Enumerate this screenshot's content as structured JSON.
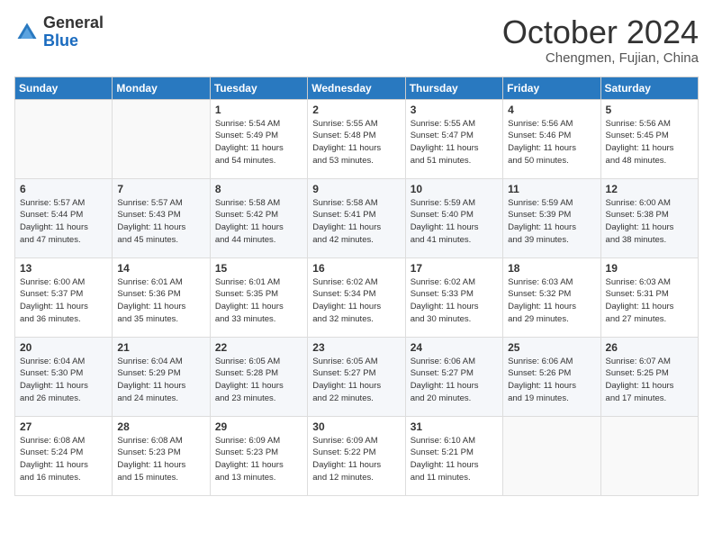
{
  "header": {
    "logo_general": "General",
    "logo_blue": "Blue",
    "month": "October 2024",
    "location": "Chengmen, Fujian, China"
  },
  "weekdays": [
    "Sunday",
    "Monday",
    "Tuesday",
    "Wednesday",
    "Thursday",
    "Friday",
    "Saturday"
  ],
  "weeks": [
    [
      {
        "day": "",
        "info": ""
      },
      {
        "day": "",
        "info": ""
      },
      {
        "day": "1",
        "info": "Sunrise: 5:54 AM\nSunset: 5:49 PM\nDaylight: 11 hours\nand 54 minutes."
      },
      {
        "day": "2",
        "info": "Sunrise: 5:55 AM\nSunset: 5:48 PM\nDaylight: 11 hours\nand 53 minutes."
      },
      {
        "day": "3",
        "info": "Sunrise: 5:55 AM\nSunset: 5:47 PM\nDaylight: 11 hours\nand 51 minutes."
      },
      {
        "day": "4",
        "info": "Sunrise: 5:56 AM\nSunset: 5:46 PM\nDaylight: 11 hours\nand 50 minutes."
      },
      {
        "day": "5",
        "info": "Sunrise: 5:56 AM\nSunset: 5:45 PM\nDaylight: 11 hours\nand 48 minutes."
      }
    ],
    [
      {
        "day": "6",
        "info": "Sunrise: 5:57 AM\nSunset: 5:44 PM\nDaylight: 11 hours\nand 47 minutes."
      },
      {
        "day": "7",
        "info": "Sunrise: 5:57 AM\nSunset: 5:43 PM\nDaylight: 11 hours\nand 45 minutes."
      },
      {
        "day": "8",
        "info": "Sunrise: 5:58 AM\nSunset: 5:42 PM\nDaylight: 11 hours\nand 44 minutes."
      },
      {
        "day": "9",
        "info": "Sunrise: 5:58 AM\nSunset: 5:41 PM\nDaylight: 11 hours\nand 42 minutes."
      },
      {
        "day": "10",
        "info": "Sunrise: 5:59 AM\nSunset: 5:40 PM\nDaylight: 11 hours\nand 41 minutes."
      },
      {
        "day": "11",
        "info": "Sunrise: 5:59 AM\nSunset: 5:39 PM\nDaylight: 11 hours\nand 39 minutes."
      },
      {
        "day": "12",
        "info": "Sunrise: 6:00 AM\nSunset: 5:38 PM\nDaylight: 11 hours\nand 38 minutes."
      }
    ],
    [
      {
        "day": "13",
        "info": "Sunrise: 6:00 AM\nSunset: 5:37 PM\nDaylight: 11 hours\nand 36 minutes."
      },
      {
        "day": "14",
        "info": "Sunrise: 6:01 AM\nSunset: 5:36 PM\nDaylight: 11 hours\nand 35 minutes."
      },
      {
        "day": "15",
        "info": "Sunrise: 6:01 AM\nSunset: 5:35 PM\nDaylight: 11 hours\nand 33 minutes."
      },
      {
        "day": "16",
        "info": "Sunrise: 6:02 AM\nSunset: 5:34 PM\nDaylight: 11 hours\nand 32 minutes."
      },
      {
        "day": "17",
        "info": "Sunrise: 6:02 AM\nSunset: 5:33 PM\nDaylight: 11 hours\nand 30 minutes."
      },
      {
        "day": "18",
        "info": "Sunrise: 6:03 AM\nSunset: 5:32 PM\nDaylight: 11 hours\nand 29 minutes."
      },
      {
        "day": "19",
        "info": "Sunrise: 6:03 AM\nSunset: 5:31 PM\nDaylight: 11 hours\nand 27 minutes."
      }
    ],
    [
      {
        "day": "20",
        "info": "Sunrise: 6:04 AM\nSunset: 5:30 PM\nDaylight: 11 hours\nand 26 minutes."
      },
      {
        "day": "21",
        "info": "Sunrise: 6:04 AM\nSunset: 5:29 PM\nDaylight: 11 hours\nand 24 minutes."
      },
      {
        "day": "22",
        "info": "Sunrise: 6:05 AM\nSunset: 5:28 PM\nDaylight: 11 hours\nand 23 minutes."
      },
      {
        "day": "23",
        "info": "Sunrise: 6:05 AM\nSunset: 5:27 PM\nDaylight: 11 hours\nand 22 minutes."
      },
      {
        "day": "24",
        "info": "Sunrise: 6:06 AM\nSunset: 5:27 PM\nDaylight: 11 hours\nand 20 minutes."
      },
      {
        "day": "25",
        "info": "Sunrise: 6:06 AM\nSunset: 5:26 PM\nDaylight: 11 hours\nand 19 minutes."
      },
      {
        "day": "26",
        "info": "Sunrise: 6:07 AM\nSunset: 5:25 PM\nDaylight: 11 hours\nand 17 minutes."
      }
    ],
    [
      {
        "day": "27",
        "info": "Sunrise: 6:08 AM\nSunset: 5:24 PM\nDaylight: 11 hours\nand 16 minutes."
      },
      {
        "day": "28",
        "info": "Sunrise: 6:08 AM\nSunset: 5:23 PM\nDaylight: 11 hours\nand 15 minutes."
      },
      {
        "day": "29",
        "info": "Sunrise: 6:09 AM\nSunset: 5:23 PM\nDaylight: 11 hours\nand 13 minutes."
      },
      {
        "day": "30",
        "info": "Sunrise: 6:09 AM\nSunset: 5:22 PM\nDaylight: 11 hours\nand 12 minutes."
      },
      {
        "day": "31",
        "info": "Sunrise: 6:10 AM\nSunset: 5:21 PM\nDaylight: 11 hours\nand 11 minutes."
      },
      {
        "day": "",
        "info": ""
      },
      {
        "day": "",
        "info": ""
      }
    ]
  ]
}
